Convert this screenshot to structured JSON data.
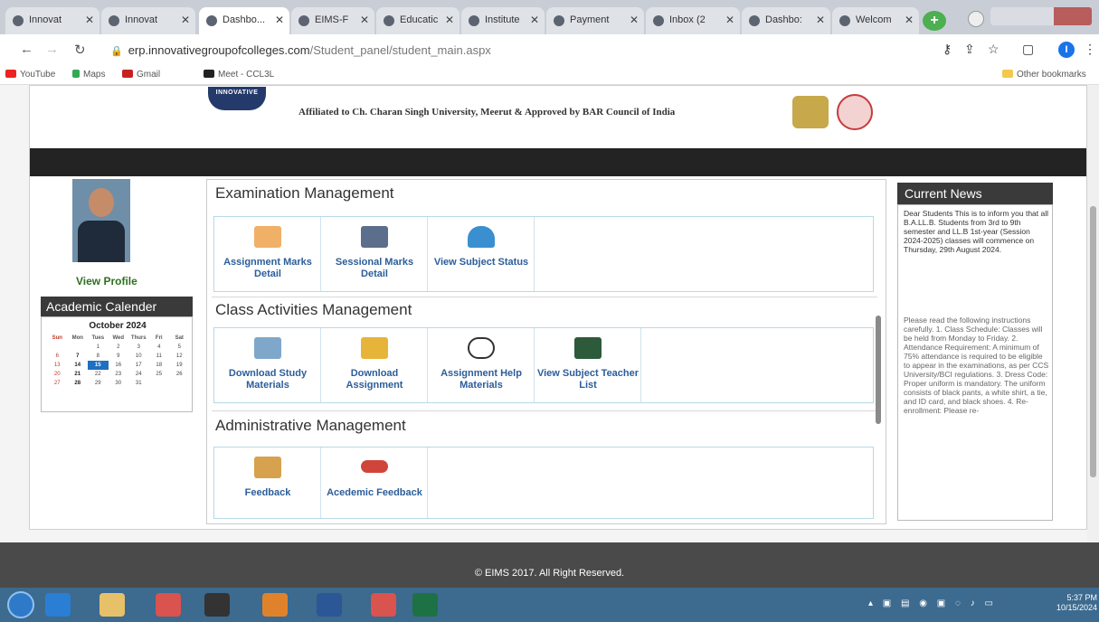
{
  "browser": {
    "tabs": [
      {
        "label": "Innovat"
      },
      {
        "label": "Innovat"
      },
      {
        "label": "Dashbo..."
      },
      {
        "label": "EIMS-F"
      },
      {
        "label": "Educatic"
      },
      {
        "label": "Institute"
      },
      {
        "label": "Payment"
      },
      {
        "label": "Inbox (2"
      },
      {
        "label": "Dashbo:"
      },
      {
        "label": "Welcom"
      }
    ],
    "new_tab": "+",
    "url_host": "erp.innovativegroupofcolleges.com",
    "url_path": "/Student_panel/student_main.aspx",
    "user_initial": "I",
    "bookmarks": [
      "YouTube",
      "Maps",
      "Gmail",
      "Meet - CCL3L"
    ],
    "other_bookmarks": "Other bookmarks"
  },
  "header": {
    "logo_text": "INNOVATIVE",
    "affiliated": "Affiliated to Ch. Charan Singh University, Meerut & Approved by BAR Council of India"
  },
  "profile": {
    "view_profile": "View Profile"
  },
  "calendar": {
    "title": "Academic Calender",
    "month": "October 2024",
    "dow": [
      "Sun",
      "Mon",
      "Tues",
      "Wed",
      "Thurs",
      "Fri",
      "Sat"
    ],
    "weeks": [
      [
        "",
        "",
        "1",
        "2",
        "3",
        "4",
        "5"
      ],
      [
        "6",
        "7",
        "8",
        "9",
        "10",
        "11",
        "12"
      ],
      [
        "13",
        "14",
        "15",
        "16",
        "17",
        "18",
        "19"
      ],
      [
        "20",
        "21",
        "22",
        "23",
        "24",
        "25",
        "26"
      ],
      [
        "27",
        "28",
        "29",
        "30",
        "31",
        "",
        ""
      ]
    ],
    "today": "15"
  },
  "sections": {
    "exam": {
      "title": "Examination Management",
      "items": [
        "Assignment Marks Detail",
        "Sessional Marks Detail",
        "View Subject Status"
      ]
    },
    "class": {
      "title": "Class Activities Management",
      "items": [
        "Download Study Materials",
        "Download Assignment",
        "Assignment Help Materials",
        "View Subject Teacher List"
      ]
    },
    "admin": {
      "title": "Administrative Management",
      "items": [
        "Feedback",
        "Acedemic Feedback"
      ]
    }
  },
  "news": {
    "title": "Current News",
    "p1": "Dear Students This is to inform you that all B.A.LL.B. Students from 3rd to 9th semester and LL.B 1st-year (Session 2024-2025) classes will commence on Thursday, 29th August 2024.",
    "p2": "Please read the following instructions carefully. 1. Class Schedule: Classes will be held from Monday to Friday. 2. Attendance Requirement: A minimum of 75% attendance is required to be eligible to appear in the examinations, as per CCS University/BCI regulations. 3. Dress Code: Proper uniform is mandatory. The uniform consists of black pants, a white shirt, a tie, and ID card, and black shoes. 4. Re-enrollment: Please re-"
  },
  "footer": {
    "text": "© EIMS 2017. All Right Reserved."
  },
  "taskbar": {
    "time": "5:37 PM",
    "date": "10/15/2024"
  },
  "colors": {
    "dark_bar": "#232323",
    "link_blue": "#2b5d9a",
    "profile_green": "#2f6f1f",
    "today_blue": "#1f6fc2"
  }
}
